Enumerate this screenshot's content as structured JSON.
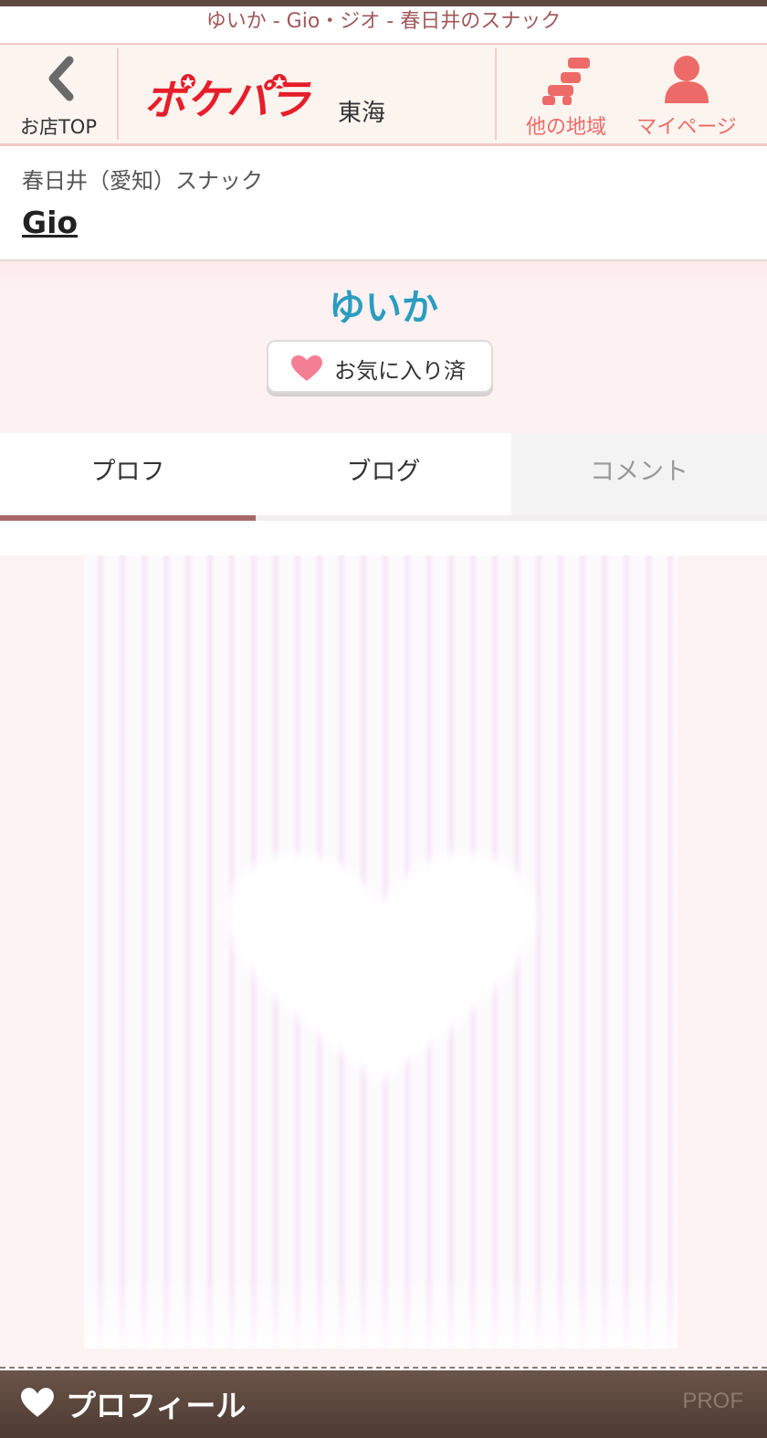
{
  "page_title": "ゆいか - Gio・ジオ - 春日井のスナック",
  "header": {
    "back_label": "お店TOP",
    "logo_text": "ポケパラ",
    "region": "東海",
    "other_area_label": "他の地域",
    "mypage_label": "マイページ"
  },
  "shop": {
    "category": "春日井（愛知）スナック",
    "name": "Gio"
  },
  "girl": {
    "name": "ゆいか",
    "favorite_label": "お気に入り済"
  },
  "tabs": [
    {
      "label": "プロフ",
      "state": "active"
    },
    {
      "label": "ブログ",
      "state": "normal"
    },
    {
      "label": "コメント",
      "state": "disabled"
    }
  ],
  "footer": {
    "title": "プロフィール",
    "en": "PROF"
  },
  "colors": {
    "accent": "#ec6b68",
    "name_color": "#2a9dc0",
    "tab_active": "#a8686b",
    "footer_bg": "#5b463c"
  },
  "icons": [
    "chevron-left-icon",
    "logo",
    "seat-icon",
    "person-icon",
    "heart-icon"
  ]
}
